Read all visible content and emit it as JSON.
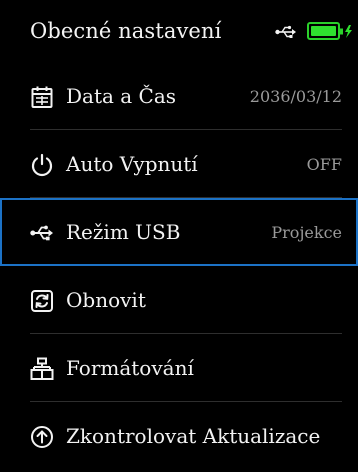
{
  "header": {
    "title": "Obecné nastavení",
    "usb_icon": "usb-icon",
    "battery_icon": "battery-charging-icon",
    "battery_level": 1.0,
    "battery_color": "#2fe02f"
  },
  "colors": {
    "background": "#000000",
    "selection_border": "#1c72c6",
    "value_text": "#9a9a9a"
  },
  "menu": {
    "selected_index": 2,
    "items": [
      {
        "icon": "calendar-icon",
        "label": "Data a Čas",
        "value": "2036/03/12"
      },
      {
        "icon": "power-icon",
        "label": "Auto Vypnutí",
        "value": "OFF"
      },
      {
        "icon": "usb-icon",
        "label": "Režim USB",
        "value": "Projekce"
      },
      {
        "icon": "refresh-icon",
        "label": "Obnovit",
        "value": ""
      },
      {
        "icon": "format-icon",
        "label": "Formátování",
        "value": ""
      },
      {
        "icon": "update-icon",
        "label": "Zkontrolovat Aktualizace",
        "value": ""
      }
    ]
  }
}
